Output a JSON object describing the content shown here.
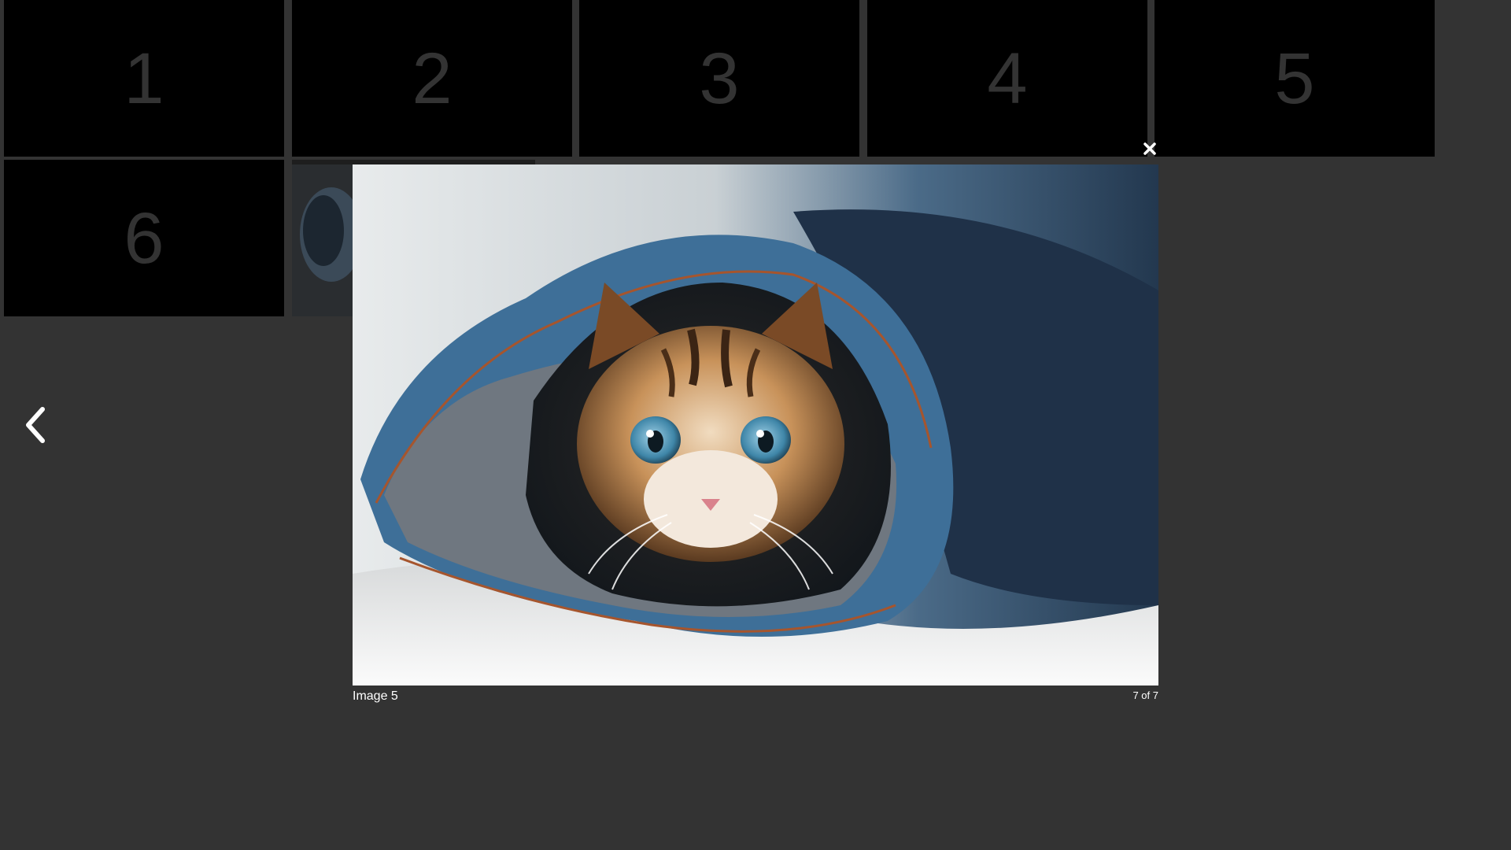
{
  "gallery": {
    "tiles": [
      {
        "label": "1"
      },
      {
        "label": "2"
      },
      {
        "label": "3"
      },
      {
        "label": "4"
      },
      {
        "label": "5"
      },
      {
        "label": "6"
      }
    ],
    "thumbnail_7": {
      "description_icon": "kitten-thumbnail-image"
    }
  },
  "lightbox": {
    "caption": "Image 5",
    "counter": "7 of 7",
    "image_icon": "kitten-in-jeans-photo",
    "close_icon": "close-icon",
    "prev_icon": "chevron-left-icon"
  },
  "colors": {
    "page_background": "#333333",
    "tile_background": "#000000",
    "tile_number": "#333333",
    "text": "#ffffff"
  }
}
